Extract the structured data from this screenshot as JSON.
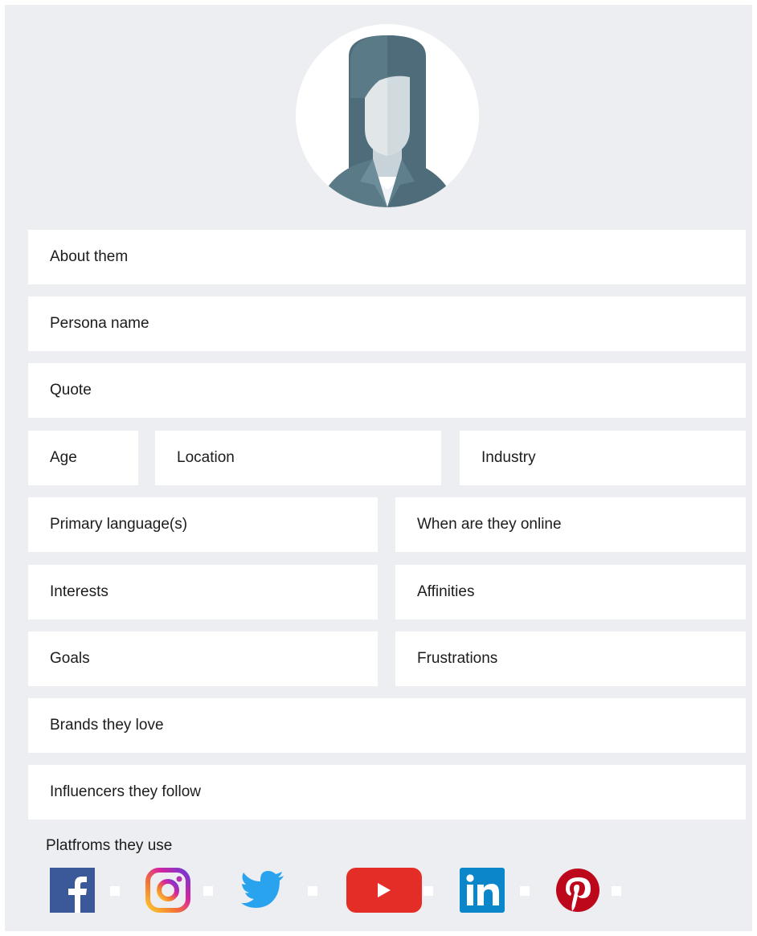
{
  "fields": {
    "about": "About them",
    "persona_name": "Persona name",
    "quote": "Quote",
    "age": "Age",
    "location": "Location",
    "industry": "Industry",
    "primary_language": "Primary language(s)",
    "when_online": "When are they online",
    "interests": "Interests",
    "affinities": "Affinities",
    "goals": "Goals",
    "frustrations": "Frustrations",
    "brands": "Brands they love",
    "influencers": "Influencers they follow"
  },
  "platforms": {
    "label": "Platfroms they use",
    "icons": [
      "facebook-icon",
      "instagram-icon",
      "twitter-icon",
      "youtube-icon",
      "linkedin-icon",
      "pinterest-icon"
    ]
  },
  "colors": {
    "background": "#edeef1",
    "field": "#ffffff",
    "avatar_primary": "#5a7a88",
    "facebook": "#3b5998",
    "twitter": "#1da1f2",
    "youtube": "#e52d27",
    "linkedin": "#0077b5",
    "pinterest": "#bd081c"
  }
}
